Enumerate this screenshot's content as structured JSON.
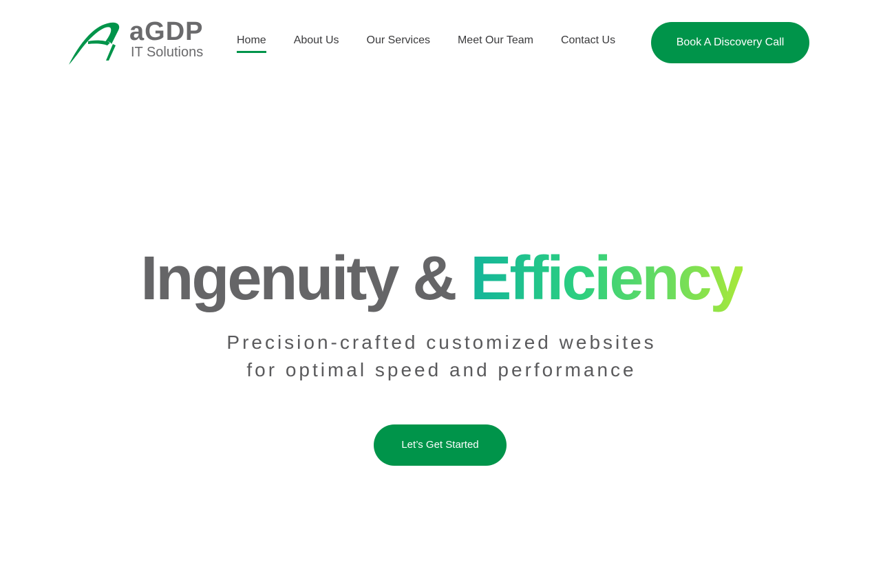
{
  "brand": {
    "name": "aGDP",
    "tagline": "IT Solutions",
    "logo_icon": "swoosh-a-logo-icon"
  },
  "nav": {
    "items": [
      {
        "label": "Home",
        "active": true
      },
      {
        "label": "About Us",
        "active": false
      },
      {
        "label": "Our Services",
        "active": false
      },
      {
        "label": "Meet Our Team",
        "active": false
      },
      {
        "label": "Contact Us",
        "active": false
      }
    ],
    "cta_label": "Book A Discovery Call"
  },
  "hero": {
    "title_part1": "Ingenuity & ",
    "title_part2": "Efficiency",
    "subtitle_line1": "Precision-crafted customized websites",
    "subtitle_line2": "for optimal speed and performance",
    "cta_label": "Let’s Get Started"
  },
  "colors": {
    "accent": "#00944a",
    "text_grey": "#656567",
    "gradient_start": "#14b59a",
    "gradient_end": "#a8e83a"
  }
}
